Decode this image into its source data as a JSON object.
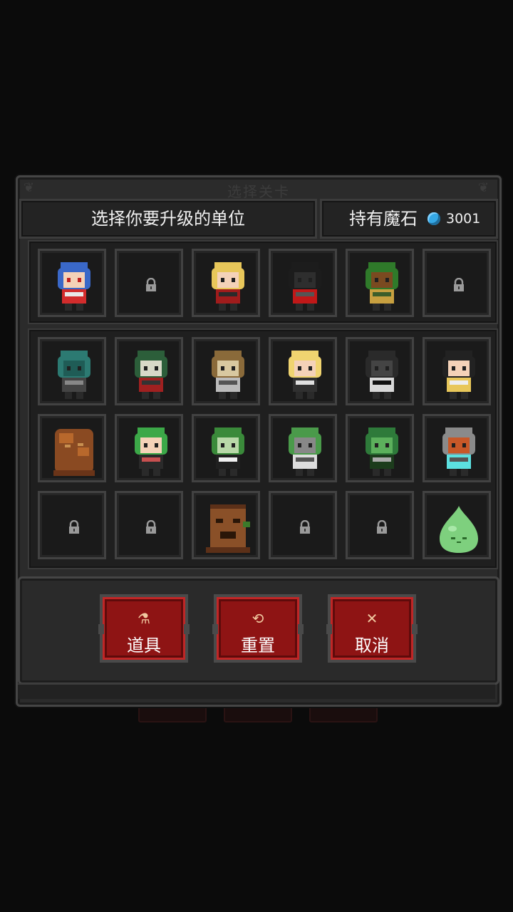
{
  "dialog": {
    "title": "选择关卡",
    "instruction": "选择你要升级的单位",
    "magic_stone_label": "持有魔石",
    "magic_stone_count": "3001",
    "accent_color": "#8e1414",
    "stone_color": "#35a8e6"
  },
  "top_row": [
    {
      "unit": "blue-hair-princess",
      "locked": false
    },
    {
      "locked": true
    },
    {
      "unit": "blonde-vampire-girl",
      "locked": false
    },
    {
      "unit": "hooded-dark-reaper",
      "locked": false
    },
    {
      "unit": "forest-treant-beast",
      "locked": false
    },
    {
      "locked": true
    }
  ],
  "unit_grid": [
    {
      "unit": "green-zombie",
      "locked": false
    },
    {
      "unit": "skull-mask-warrior",
      "locked": false
    },
    {
      "unit": "horned-minotaur",
      "locked": false
    },
    {
      "unit": "blonde-elf-girl",
      "locked": false
    },
    {
      "unit": "winged-demon-knight",
      "locked": false
    },
    {
      "unit": "nun-girl",
      "locked": false
    },
    {
      "unit": "rock-golem",
      "locked": false
    },
    {
      "unit": "green-hair-witch",
      "locked": false
    },
    {
      "unit": "frankenstein-suit",
      "locked": false
    },
    {
      "unit": "spiked-plant-pot",
      "locked": false
    },
    {
      "unit": "green-dragon",
      "locked": false
    },
    {
      "unit": "iron-robot",
      "locked": false
    },
    {
      "locked": true
    },
    {
      "locked": true
    },
    {
      "unit": "angry-tree-stump",
      "locked": false
    },
    {
      "locked": true
    },
    {
      "locked": true
    },
    {
      "unit": "green-slime",
      "locked": false
    }
  ],
  "actions": [
    {
      "label": "道具",
      "icon": "potion-icon"
    },
    {
      "label": "重置",
      "icon": "refresh-icon"
    },
    {
      "label": "取消",
      "icon": "close-icon"
    }
  ]
}
